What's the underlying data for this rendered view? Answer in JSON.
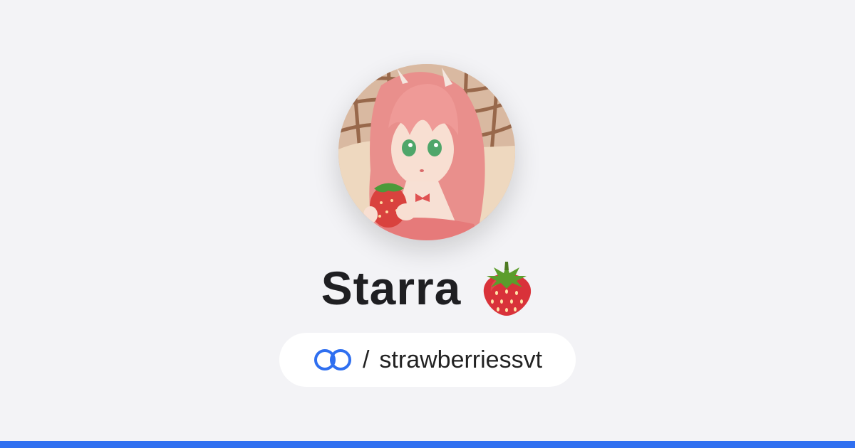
{
  "profile": {
    "display_name": "Starra",
    "name_emoji_icon": "strawberry-icon",
    "handle_prefix": "/",
    "handle": "strawberriessvt",
    "link_icon": "link-rings-icon",
    "avatar_icon": "avatar-image"
  },
  "colors": {
    "background": "#f3f3f6",
    "accent": "#2f6ff0",
    "title_text": "#1f1f22",
    "pill_background": "#ffffff"
  }
}
